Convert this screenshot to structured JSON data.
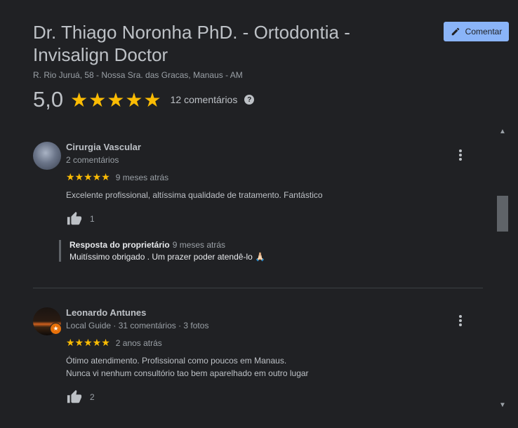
{
  "place": {
    "title": "Dr. Thiago Noronha PhD. - Ortodontia - Invisalign Doctor",
    "address": "R. Rio Juruá, 58 - Nossa Sra. das Gracas, Manaus - AM",
    "rating": "5,0",
    "stars": "★★★★★",
    "reviews_count": "12 comentários",
    "help_icon": "?"
  },
  "actions": {
    "comment_label": "Comentar"
  },
  "reviews": [
    {
      "author": "Cirurgia Vascular",
      "meta": "2 comentários",
      "stars": "★★★★★",
      "rating": 5,
      "time": "9 meses atrás",
      "text": "Excelente profissional, altíssima qualidade de tratamento. Fantástico",
      "likes": "1",
      "reply": {
        "label": "Resposta do proprietário",
        "time": "9 meses atrás",
        "text": "Muitíssimo obrigado . Um prazer poder atendê-lo 🙏🏻"
      }
    },
    {
      "author": "Leonardo Antunes",
      "meta": "Local Guide · 31 comentários · 3 fotos",
      "stars": "★★★★★",
      "rating": 5,
      "time": "2 anos atrás",
      "text_line1": "Ótimo atendimento. Profissional como poucos em Manaus.",
      "text_line2": "Nunca vi nenhum consultório tao bem aparelhado em outro lugar",
      "likes": "2"
    }
  ],
  "colors": {
    "background": "#202124",
    "accent": "#8ab4f8",
    "star": "#fbbc04",
    "guide_badge": "#e8710a"
  },
  "scroll_position": 0.25
}
